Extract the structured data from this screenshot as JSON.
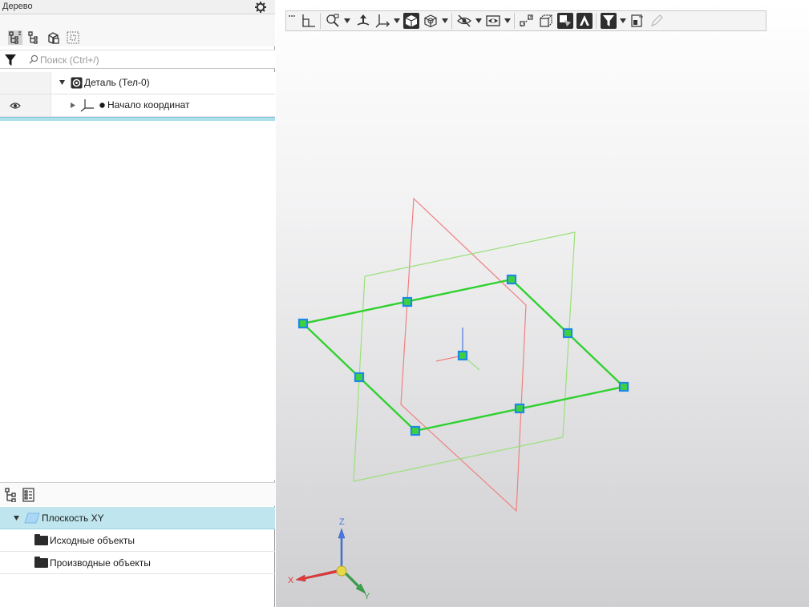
{
  "tree_panel": {
    "title": "Дерево",
    "search_placeholder": "Поиск (Ctrl+/)",
    "items": [
      {
        "label": "Деталь (Тел-0)",
        "expanded": true
      },
      {
        "label": "Начало координат",
        "expanded": false,
        "visible": true
      }
    ]
  },
  "properties_panel": {
    "items": [
      {
        "label": "Плоскость XY",
        "selected": true
      },
      {
        "label": "Исходные объекты"
      },
      {
        "label": "Производные объекты"
      }
    ]
  },
  "viewport": {
    "axis_labels": {
      "x": "X",
      "y": "Y",
      "z": "Z"
    }
  },
  "colors": {
    "accent": "#1e88e5",
    "selected_row": "#bfe6ee",
    "plane_selected": "#2ed12e",
    "plane_yz": "#f08080",
    "plane_zx": "#9be07a",
    "axis_x": "#e03a3a",
    "axis_y": "#3aa04a",
    "axis_z": "#4a78e0"
  }
}
